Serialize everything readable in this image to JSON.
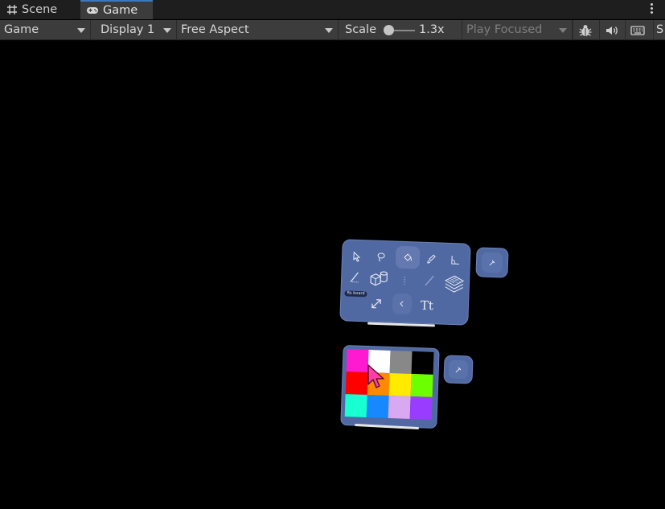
{
  "tabs": [
    {
      "label": "Scene",
      "icon": "grid-icon",
      "active": false
    },
    {
      "label": "Game",
      "icon": "gamepad-icon",
      "active": true
    }
  ],
  "toolbar": {
    "display_mode": "Game",
    "display": "Display 1",
    "aspect": "Free Aspect",
    "scale_label": "Scale",
    "scale_value": "1.3x",
    "play_mode": "Play Focused",
    "trailing": "S"
  },
  "tools_panel": {
    "badge": "Rs board",
    "text_tool": "Tt"
  },
  "palette": {
    "colors": [
      "#ff1ad1",
      "#ffffff",
      "#888888",
      "#000000",
      "#ff0000",
      "#ff8a00",
      "#ffea00",
      "#6cff00",
      "#18ffd2",
      "#1888ff",
      "#d8a8f0",
      "#9a3cff"
    ]
  },
  "colors": {
    "panel": "#5069a2",
    "tab_accent": "#3a79bb",
    "toolbar": "#3c3c3c"
  }
}
